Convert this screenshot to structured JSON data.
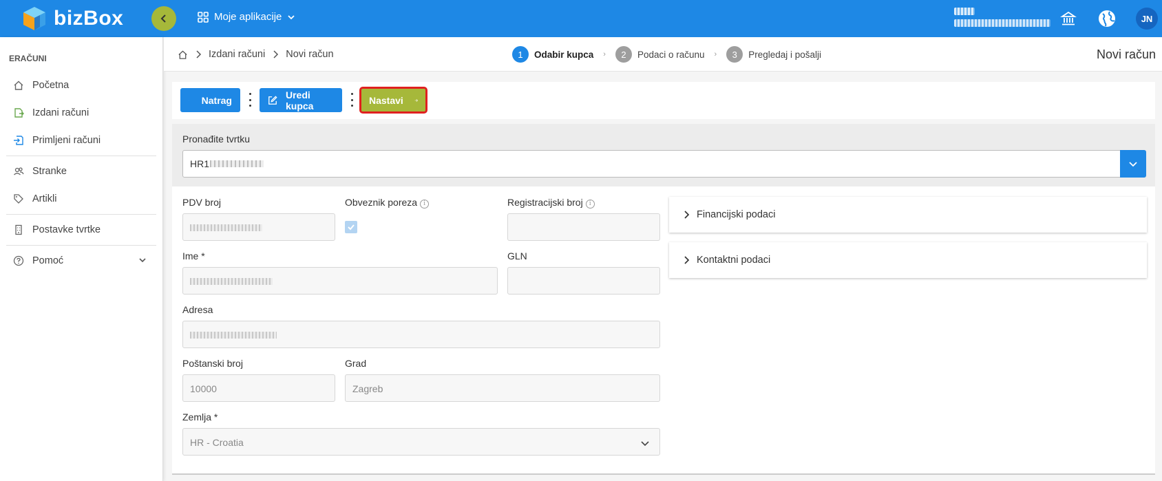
{
  "app": {
    "name": "bizBox",
    "apps_menu_label": "Moje aplikacije",
    "user_initials": "JN"
  },
  "sidebar": {
    "section": "ERAČUNI",
    "items": [
      {
        "label": "Početna",
        "icon": "home-icon"
      },
      {
        "label": "Izdani računi",
        "icon": "invoice-out-icon"
      },
      {
        "label": "Primljeni računi",
        "icon": "invoice-in-icon"
      },
      {
        "label": "Stranke",
        "icon": "users-icon"
      },
      {
        "label": "Artikli",
        "icon": "tag-icon"
      },
      {
        "label": "Postavke tvrtke",
        "icon": "building-icon"
      },
      {
        "label": "Pomoć",
        "icon": "help-icon"
      }
    ]
  },
  "breadcrumb": {
    "items": [
      "Izdani računi",
      "Novi račun"
    ]
  },
  "steps": [
    {
      "num": "1",
      "label": "Odabir kupca",
      "active": true
    },
    {
      "num": "2",
      "label": "Podaci o računu",
      "active": false
    },
    {
      "num": "3",
      "label": "Pregledaj i pošalji",
      "active": false
    }
  ],
  "page_title": "Novi račun",
  "toolbar": {
    "back_label": "Natrag",
    "edit_label": "Uredi kupca",
    "next_label": "Nastavi"
  },
  "search": {
    "label": "Pronađite tvrtku",
    "value_prefix": "HR1"
  },
  "form": {
    "pdv_label": "PDV broj",
    "taxpayer_label": "Obveznik poreza",
    "taxpayer_checked": true,
    "reg_label": "Registracijski broj",
    "name_label": "Ime *",
    "gln_label": "GLN",
    "address_label": "Adresa",
    "postal_label": "Poštanski broj",
    "postal_value": "10000",
    "city_label": "Grad",
    "city_value": "Zagreb",
    "country_label": "Zemlja *",
    "country_value": "HR - Croatia"
  },
  "accordions": {
    "financial": "Financijski podaci",
    "contact": "Kontaktni podaci"
  },
  "colors": {
    "primary": "#1e88e5",
    "accent_green": "#a6b83a",
    "highlight_red": "#e02020"
  }
}
